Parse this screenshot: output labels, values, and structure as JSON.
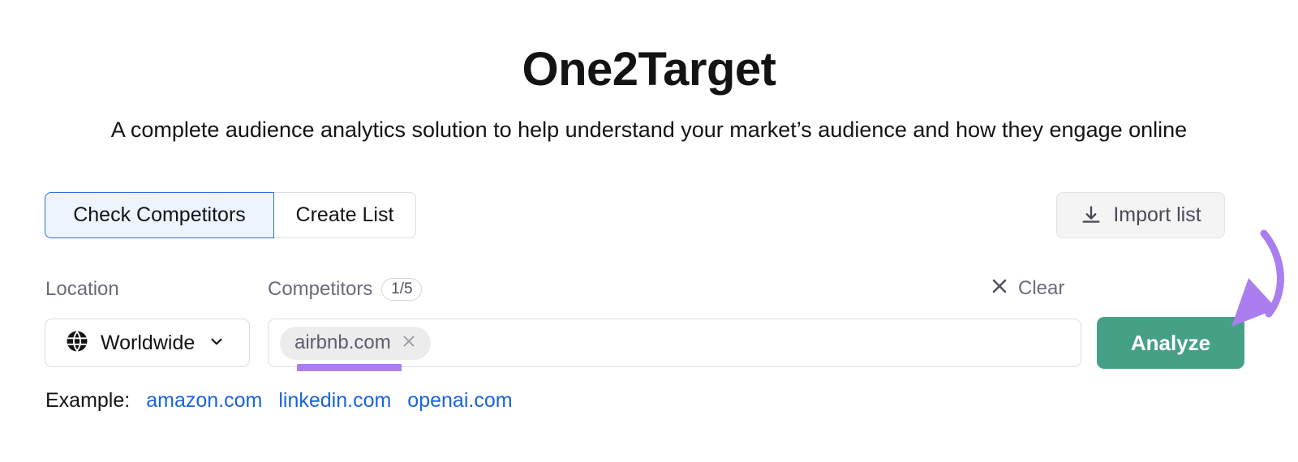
{
  "header": {
    "title": "One2Target",
    "subtitle": "A complete audience analytics solution to help understand your market’s audience and how they engage online"
  },
  "tabs": [
    {
      "label": "Check Competitors",
      "active": true
    },
    {
      "label": "Create List",
      "active": false
    }
  ],
  "toolbar": {
    "import_label": "Import list",
    "import_icon": "download-icon"
  },
  "fields": {
    "location_label": "Location",
    "location_value": "Worldwide",
    "location_icon": "globe-icon",
    "location_chevron": "chevron-down-icon",
    "competitors_label": "Competitors",
    "competitors_count": "1/5",
    "clear_label": "Clear",
    "clear_icon": "close-icon",
    "tags": [
      {
        "label": "airbnb.com",
        "remove_icon": "close-icon"
      }
    ]
  },
  "actions": {
    "analyze_label": "Analyze"
  },
  "example": {
    "label": "Example:",
    "links": [
      "amazon.com",
      "linkedin.com",
      "openai.com"
    ]
  },
  "annotations": {
    "arrow_color": "#ab7ef0",
    "underline_color": "#ab7ef0"
  },
  "colors": {
    "accent_green": "#45a085",
    "link_blue": "#1a63dd",
    "active_tab_border": "#2f6fd0",
    "active_tab_fill": "#eef4fd"
  }
}
